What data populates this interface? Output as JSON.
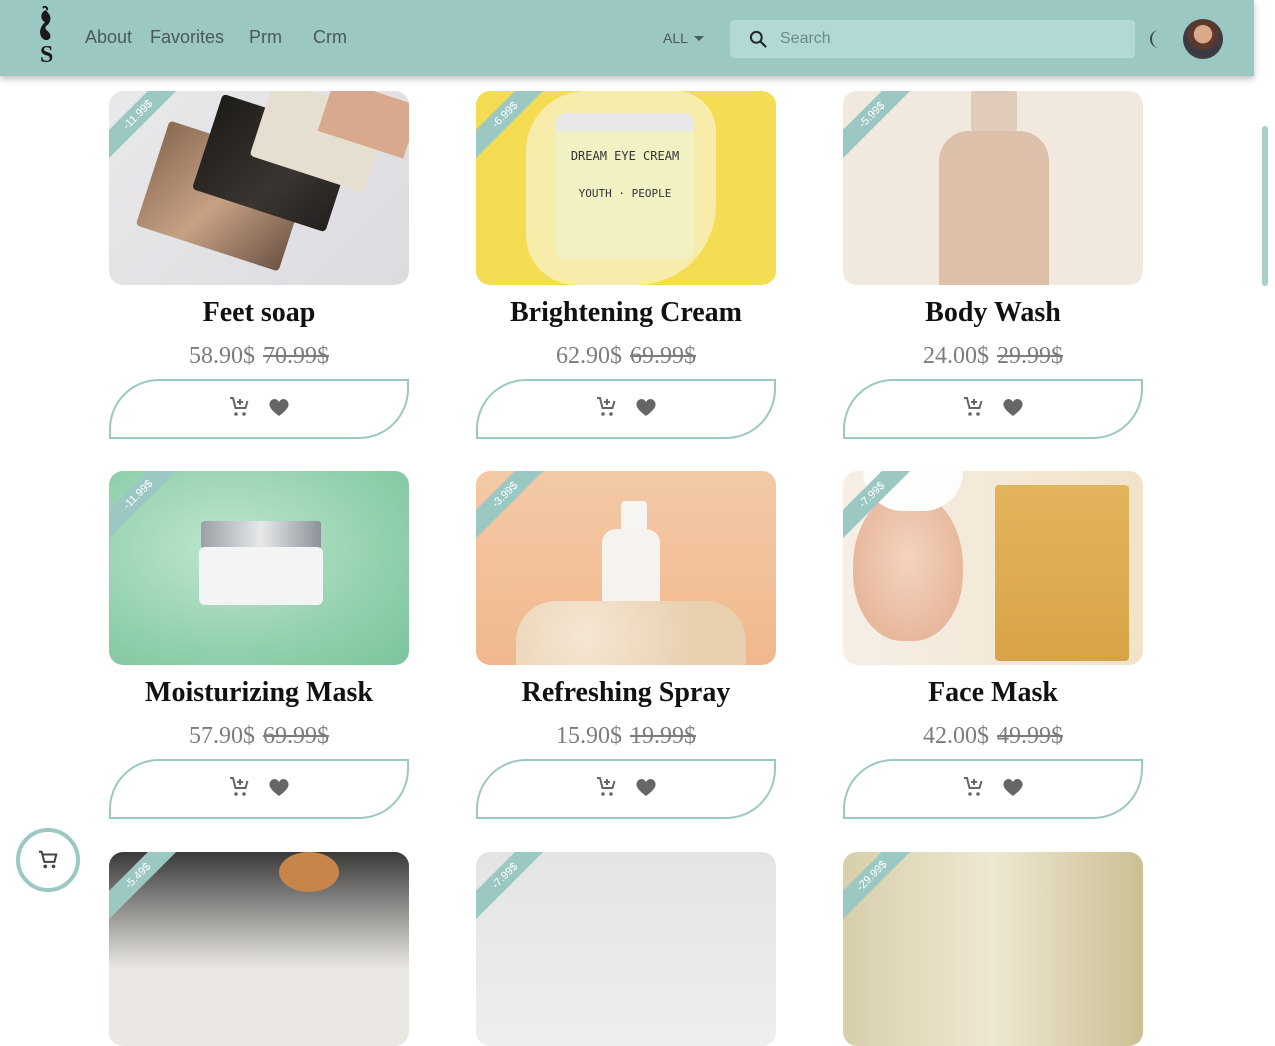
{
  "header": {
    "nav": [
      "About",
      "Favorites",
      "Prm",
      "Crm"
    ],
    "filter_label": "ALL",
    "search_placeholder": "Search",
    "colors": {
      "bar": "#9cc8c3",
      "search_bg": "#b3d9d6"
    }
  },
  "products": [
    {
      "name": "Feet soap",
      "price": "58.90$",
      "old_price": "70.99$",
      "discount": "-11.99$"
    },
    {
      "name": "Brightening Cream",
      "price": "62.90$",
      "old_price": "69.99$",
      "discount": "-6.99$"
    },
    {
      "name": "Body Wash",
      "price": "24.00$",
      "old_price": "29.99$",
      "discount": "-5.99$"
    },
    {
      "name": "Moisturizing Mask",
      "price": "57.90$",
      "old_price": "69.99$",
      "discount": "-11.99$"
    },
    {
      "name": "Refreshing Spray",
      "price": "15.90$",
      "old_price": "19.99$",
      "discount": "-3.99$"
    },
    {
      "name": "Face Mask",
      "price": "42.00$",
      "old_price": "49.99$",
      "discount": "-7.99$"
    },
    {
      "discount": "-5.49$"
    },
    {
      "discount": "-7.99$"
    },
    {
      "discount": "-29.99$"
    }
  ],
  "icons": {
    "logo": "swan-logo",
    "search": "search-icon",
    "theme": "moon-icon",
    "add_to_cart": "add-shopping-cart-icon",
    "favorite": "heart-icon",
    "cart": "shopping-cart-icon"
  }
}
